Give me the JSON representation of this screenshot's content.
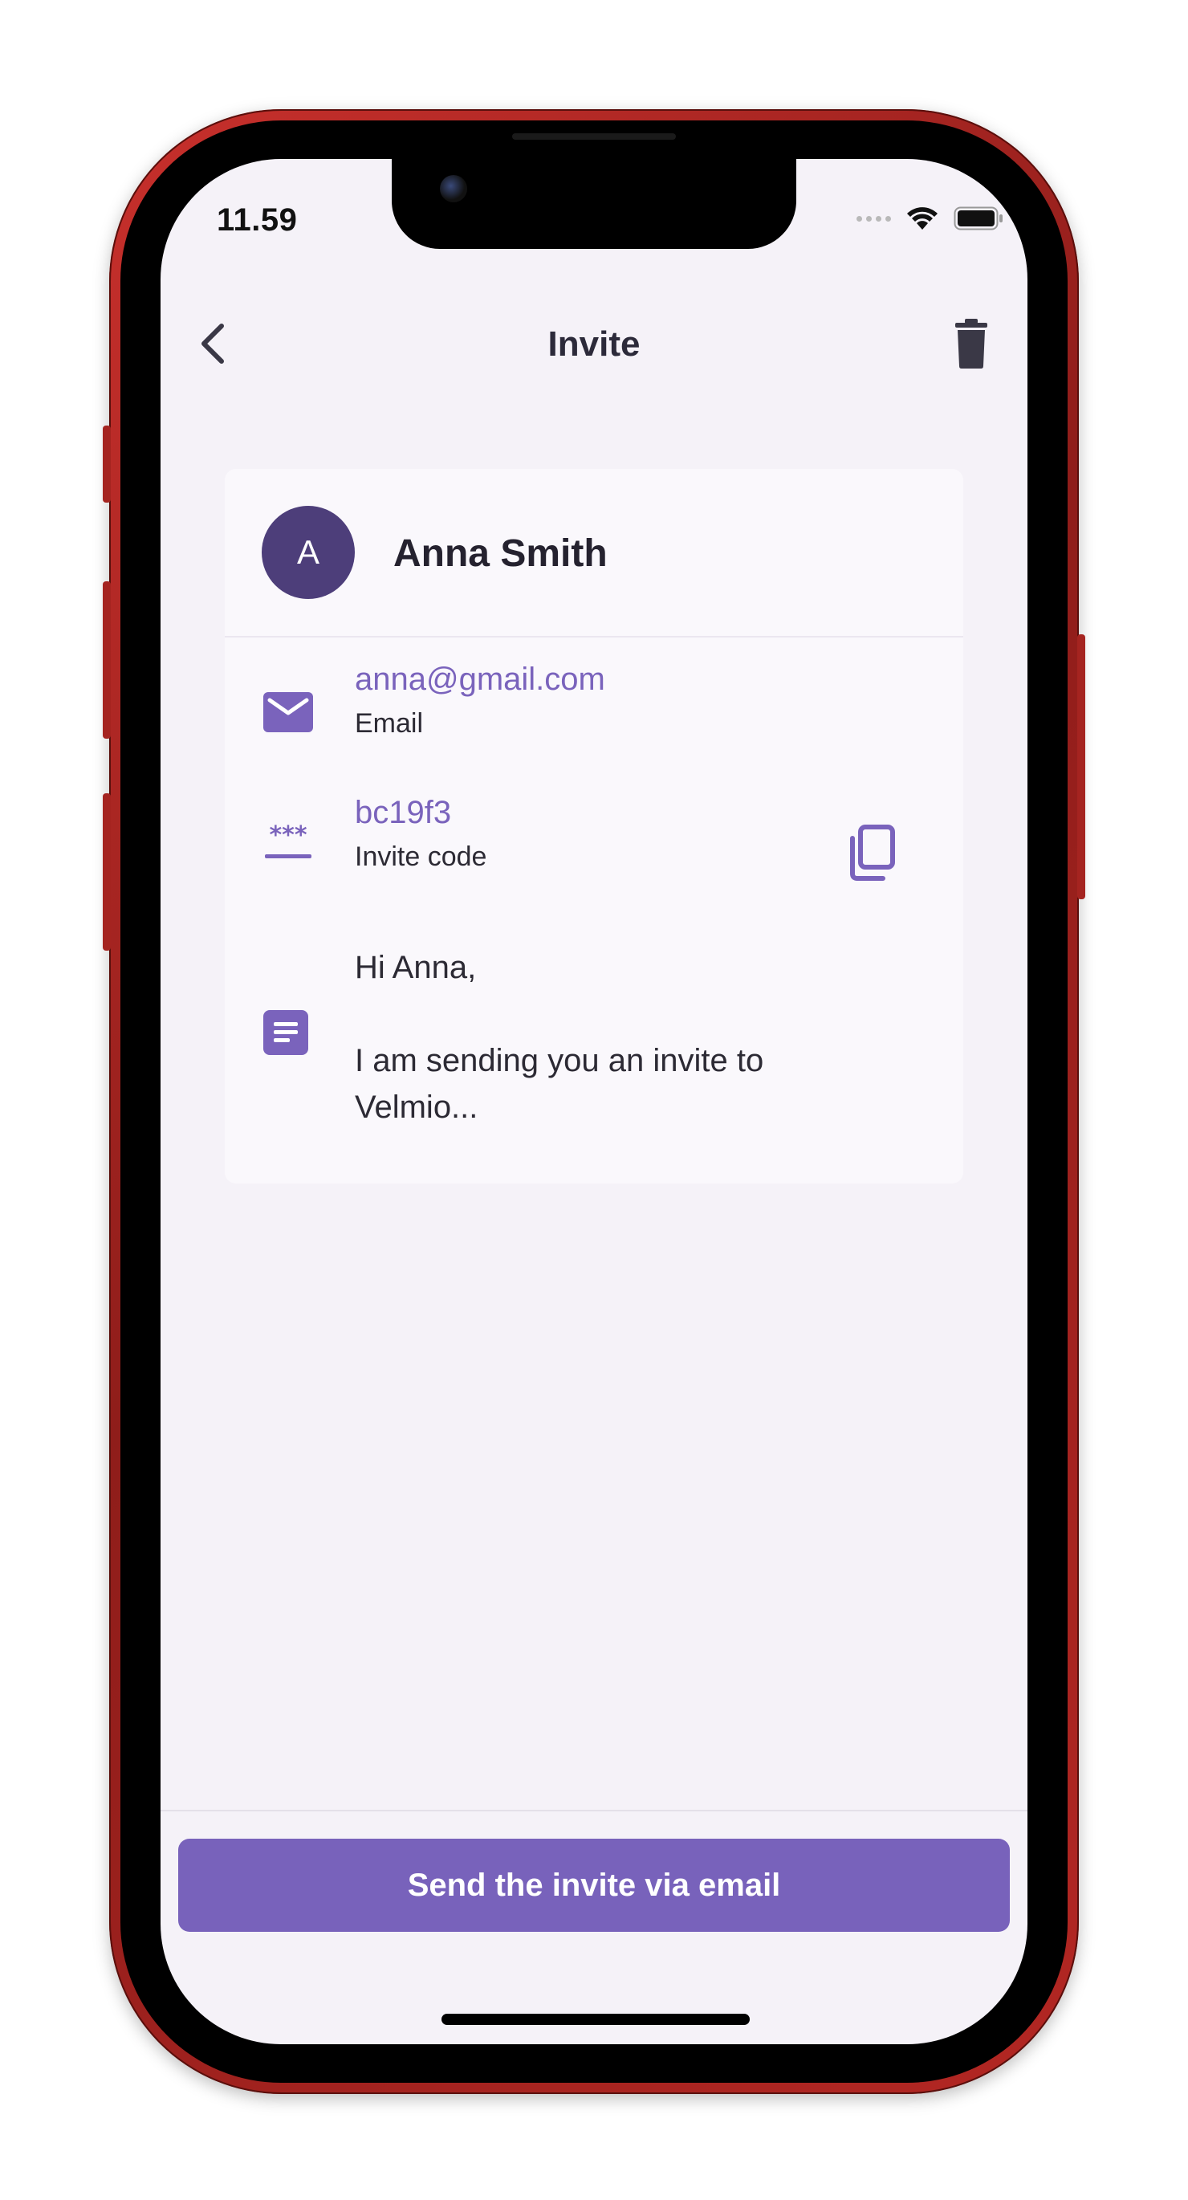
{
  "status_bar": {
    "time": "11.59",
    "signal_icon": "signal-dots-icon",
    "wifi_icon": "wifi-icon",
    "battery_icon": "battery-icon"
  },
  "nav": {
    "title": "Invite",
    "back_icon": "chevron-left-icon",
    "delete_icon": "trash-icon"
  },
  "contact": {
    "avatar_initial": "A",
    "name": "Anna Smith"
  },
  "details": {
    "email_value": "anna@gmail.com",
    "email_label": "Email",
    "code_value": "bc19f3",
    "code_label": "Invite code",
    "message": "Hi Anna,\n\nI am sending you an invite to Velmio..."
  },
  "actions": {
    "send_label": "Send the invite via email"
  },
  "colors": {
    "accent": "#7862bb",
    "avatar": "#4d3e7a",
    "screen_background": "#f5f2f8",
    "card_background": "#faf8fc",
    "frame": "#b32723"
  }
}
